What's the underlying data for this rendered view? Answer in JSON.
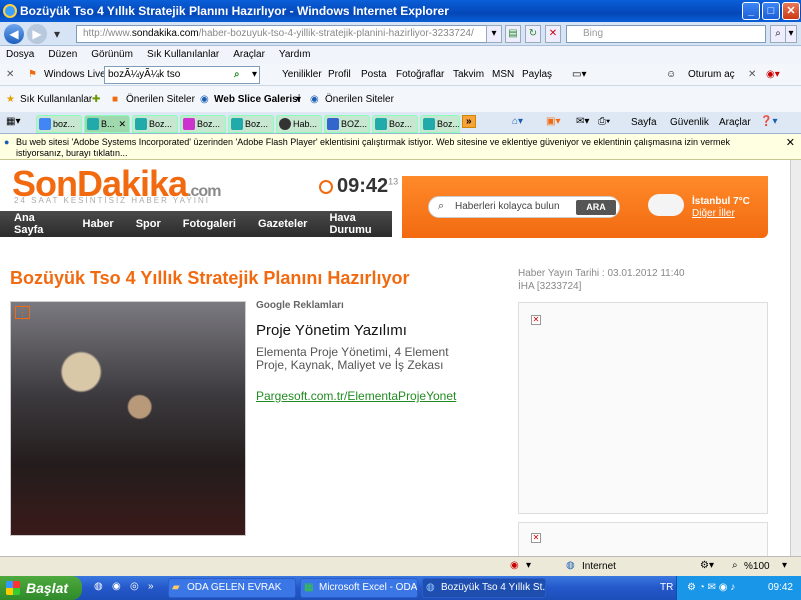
{
  "window": {
    "title": "Bozüyük Tso 4 Yıllık Stratejik Planını Hazırlıyor - Windows Internet Explorer"
  },
  "address": {
    "prefix": "http://www.",
    "domain": "sondakika.com",
    "rest": "/haber-bozuyuk-tso-4-yillik-stratejik-planini-hazirliyor-3233724/"
  },
  "search": {
    "placeholder": "Bing"
  },
  "menu": [
    "Dosya",
    "Düzen",
    "Görünüm",
    "Sık Kullanılanlar",
    "Araçlar",
    "Yardım"
  ],
  "windows_live": {
    "label": "Windows Live",
    "search_value": "bozÃ¼yÃ¼k tso",
    "items": [
      "Yenilikler",
      "Profil",
      "Posta",
      "Fotoğraflar",
      "Takvim",
      "MSN",
      "Paylaş"
    ],
    "signin": "Oturum aç"
  },
  "favorites": {
    "label": "Sık Kullanılanlar",
    "suggested": "Önerilen Siteler",
    "webslice": "Web Slice Galerisi",
    "suggested2": "Önerilen Siteler"
  },
  "tabs": [
    "boz...",
    "B...",
    "Boz...",
    "Boz...",
    "Boz...",
    "Hab...",
    "BOZ...",
    "Boz...",
    "Boz..."
  ],
  "cmdbar": {
    "page": "Sayfa",
    "safety": "Güvenlik",
    "tools": "Araçlar"
  },
  "infobar": {
    "text": "Bu web sitesi 'Adobe Systems Incorporated' üzerinden 'Adobe Flash Player' eklentisini çalıştırmak istiyor. Web sitesine ve eklentiye güveniyor ve eklentinin çalışmasına izin vermek istiyorsanız, burayı tıklatın..."
  },
  "site": {
    "logo": "SonDakika",
    "logo_com": ".com",
    "slogan": "24 SAAT KESİNTİSİZ HABER YAYINI",
    "time": "09:42",
    "seconds": "13",
    "search_placeholder": "Haberleri kolayca bulun",
    "search_btn": "ARA",
    "weather": "İstanbul 7°C",
    "weather_link": "Diğer İller",
    "nav": [
      "Ana Sayfa",
      "Haber",
      "Spor",
      "Fotogaleri",
      "Gazeteler",
      "Hava Durumu"
    ]
  },
  "article": {
    "headline": "Bozüyük Tso 4 Yıllık Stratejik Planını Hazırlıyor",
    "pubdate": "Haber Yayın Tarihi : 03.01.2012 11:40",
    "agency": "İHA [3233724]",
    "ads_label": "Google Reklamları",
    "ad_title": "Proje Yönetim Yazılımı",
    "ad_desc": "Elementa Proje Yönetimi, 4 Element Proje, Kaynak, Maliyet ve İş Zekası",
    "ad_link": "Pargesoft.com.tr/ElementaProjeYonet"
  },
  "statusbar": {
    "zone": "Internet",
    "zoom": "%100"
  },
  "taskbar": {
    "start": "Başlat",
    "tasks": [
      "ODA GELEN EVRAK",
      "Microsoft Excel - ODA...",
      "Bozüyük Tso 4 Yıllık St..."
    ],
    "lang": "TR",
    "clock": "09:42"
  }
}
